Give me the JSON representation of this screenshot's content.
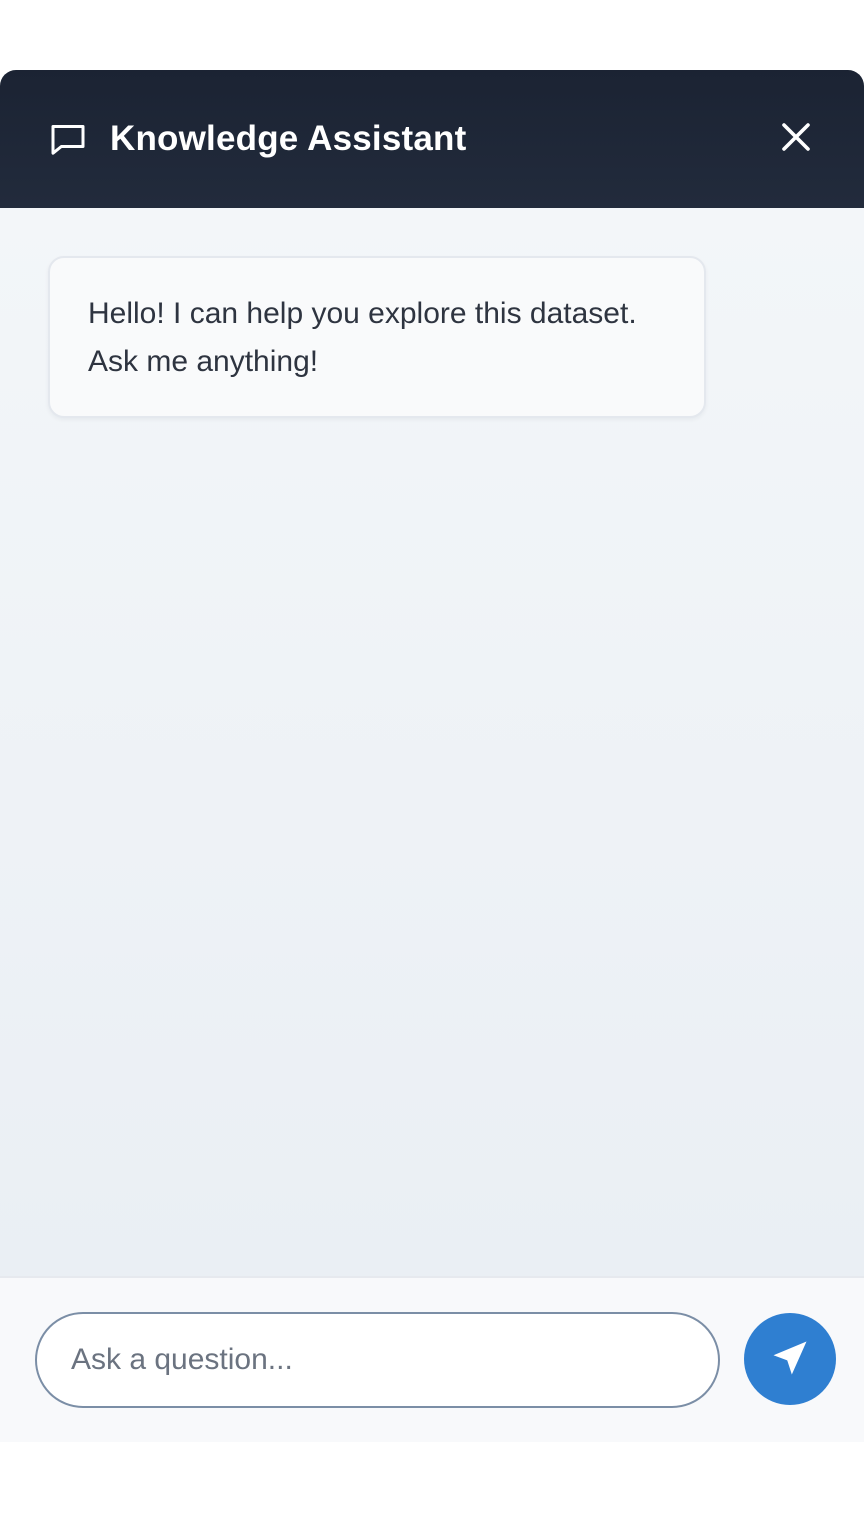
{
  "header": {
    "title": "Knowledge Assistant",
    "icon": "chat-bubble-icon",
    "close_icon": "close-icon"
  },
  "messages": [
    {
      "role": "assistant",
      "text": "Hello! I can help you explore this dataset. Ask me anything!"
    }
  ],
  "composer": {
    "value": "",
    "placeholder": "Ask a question...",
    "send_icon": "send-icon"
  },
  "colors": {
    "header_bg": "#1b2333",
    "accent": "#2f7fd1",
    "panel_bg": "#eef2f6"
  }
}
